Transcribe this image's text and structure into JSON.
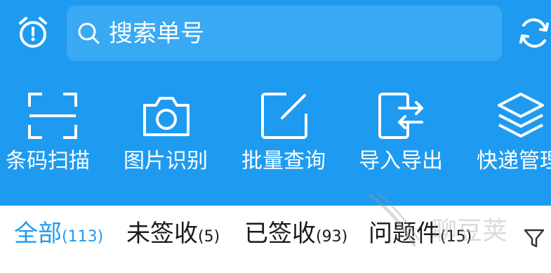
{
  "header": {
    "search_placeholder": "搜索单号",
    "alarm_icon": "alarm-clock-icon",
    "refresh_icon": "refresh-icon"
  },
  "tools": [
    {
      "label": "条码扫描",
      "icon": "scan-icon"
    },
    {
      "label": "图片识别",
      "icon": "camera-icon"
    },
    {
      "label": "批量查询",
      "icon": "edit-icon"
    },
    {
      "label": "导入导出",
      "icon": "import-export-icon"
    },
    {
      "label": "快递管理",
      "icon": "layers-icon"
    }
  ],
  "tabs": [
    {
      "name": "全部",
      "count": "(113)",
      "active": true
    },
    {
      "name": "未签收",
      "count": "(5)",
      "active": false
    },
    {
      "name": "已签收",
      "count": "(93)",
      "active": false
    },
    {
      "name": "问题件",
      "count": "(15)",
      "active": false
    }
  ],
  "filter_icon": "filter-icon",
  "watermark": {
    "text": "聊豆荚"
  },
  "colors": {
    "primary": "#1e9bf0",
    "search_bg": "#3aa9f4",
    "text": "#1a1a1a"
  }
}
